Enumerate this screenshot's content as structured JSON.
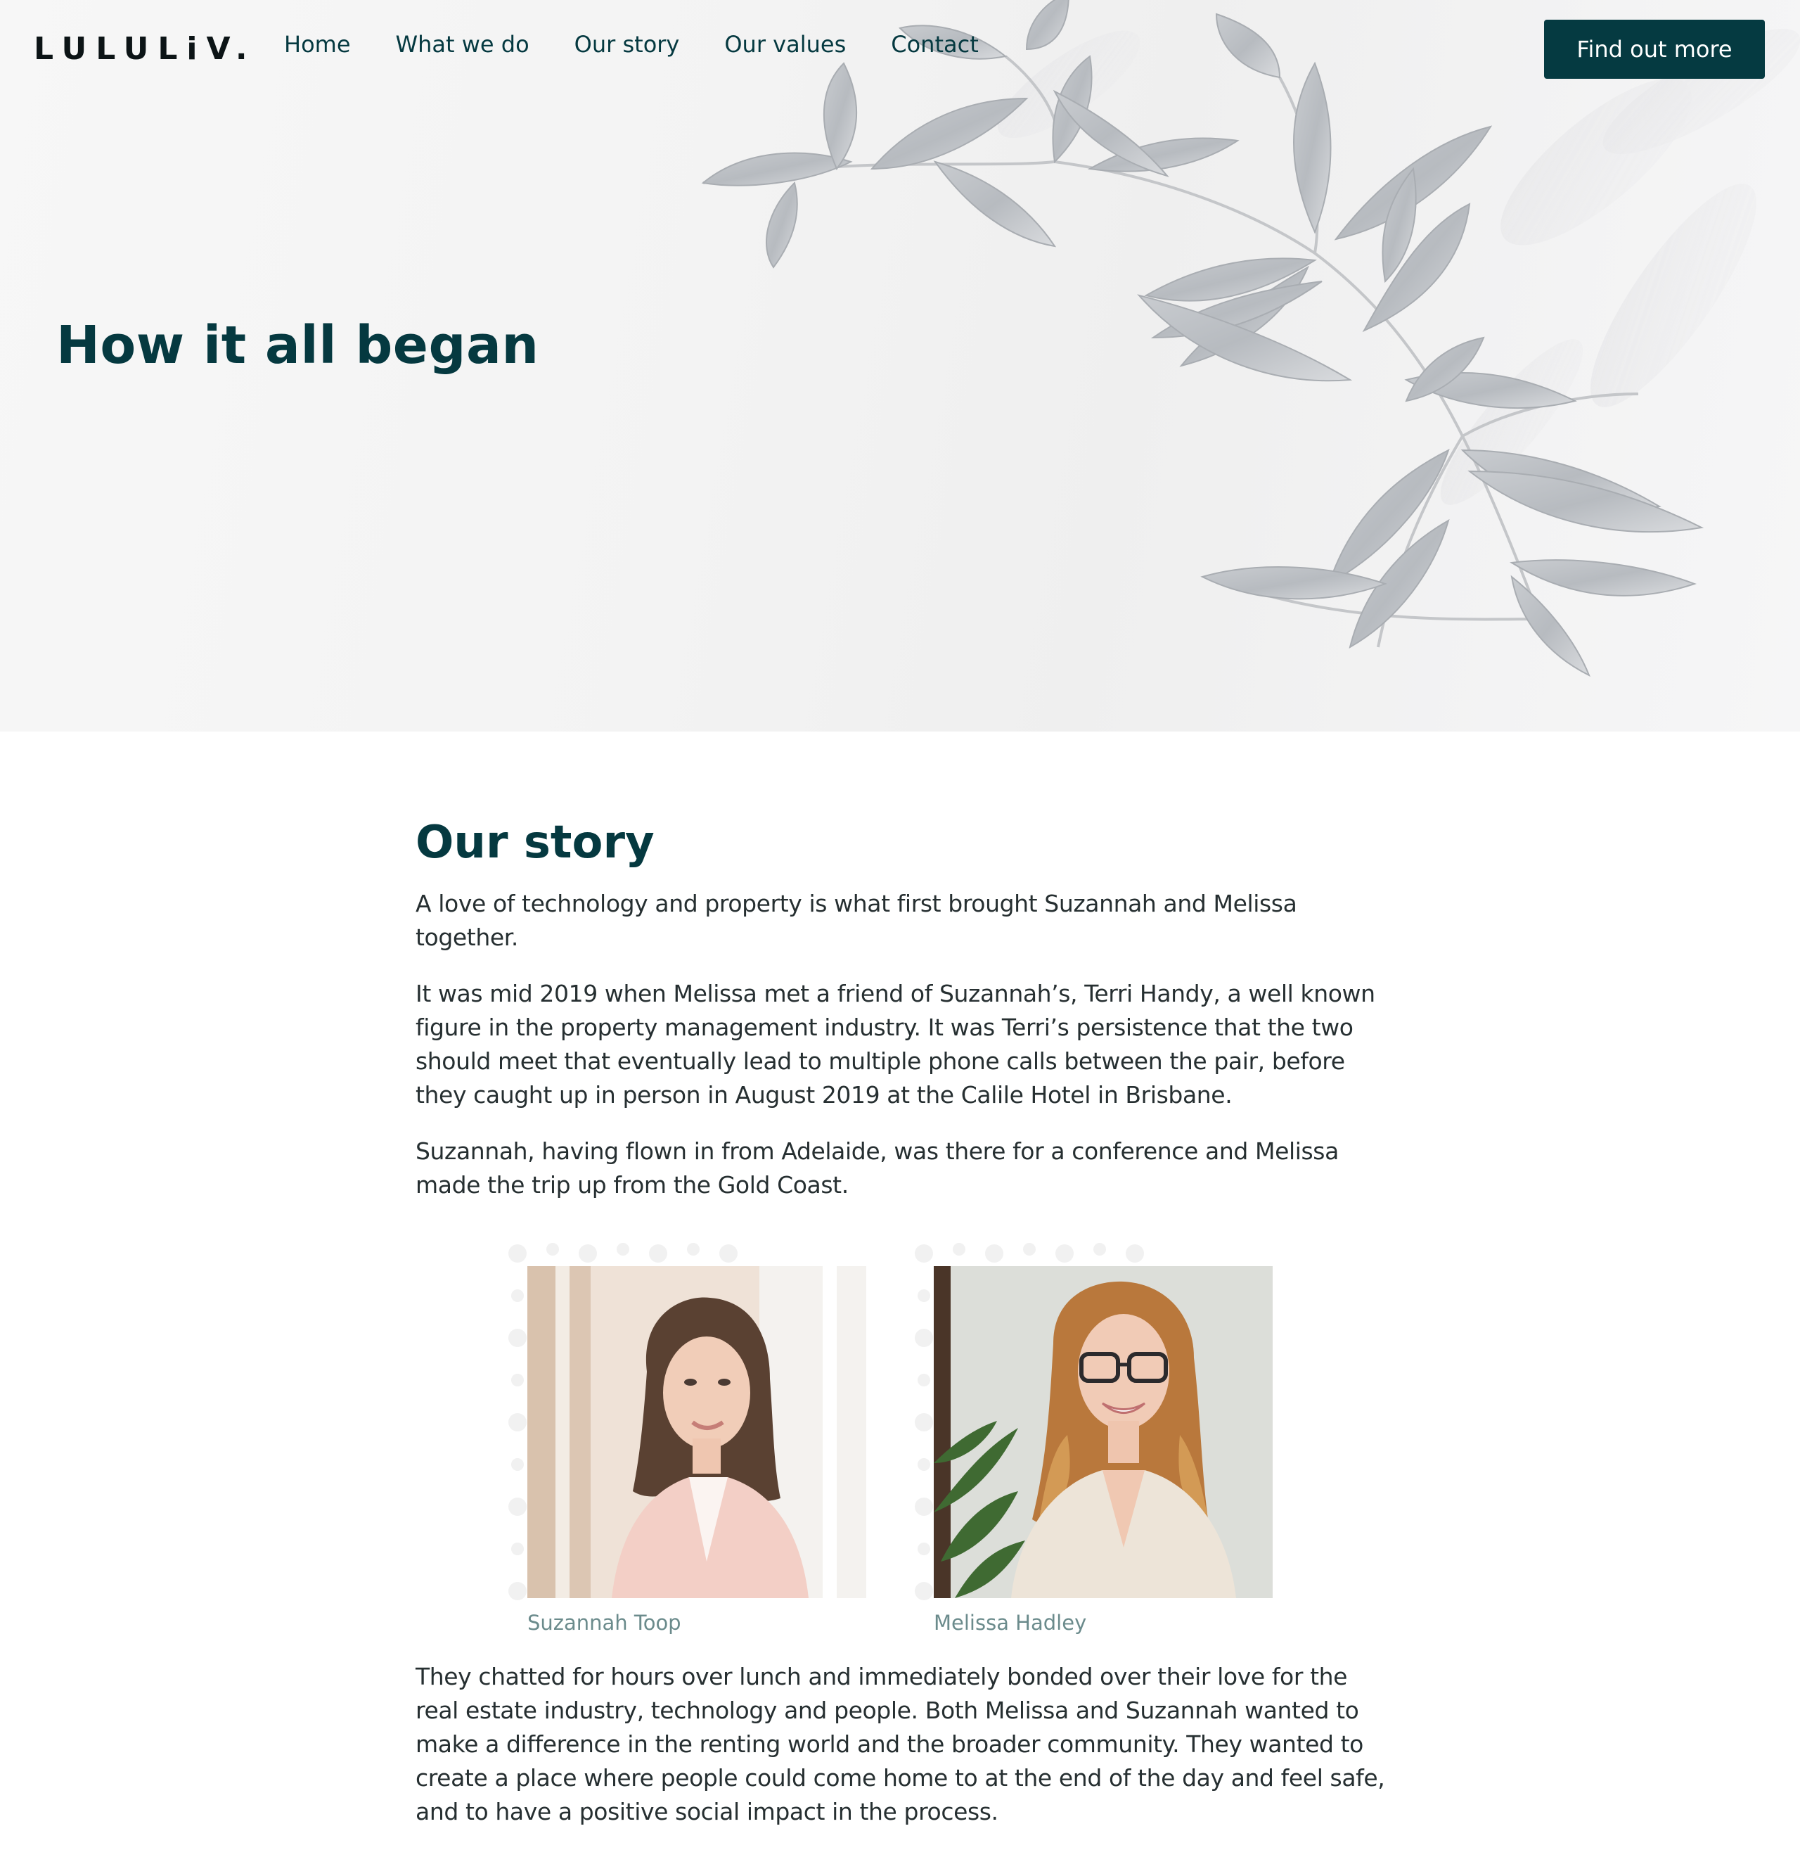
{
  "header": {
    "logo_text": "LULULiV.",
    "nav": [
      "Home",
      "What we do",
      "Our story",
      "Our values",
      "Contact"
    ],
    "cta_label": "Find out more"
  },
  "hero": {
    "title": "How it all began"
  },
  "story": {
    "title": "Our story",
    "paragraphs": [
      "A love of technology and property is what first brought Suzannah and Melissa together.",
      "It was mid 2019 when Melissa met a friend of Suzannah’s, Terri Handy, a well known figure in the property management industry. It was Terri’s persistence that the two should meet that eventually lead to multiple phone calls between the pair, before they caught up in person in August 2019 at the Calile Hotel in Brisbane.",
      "Suzannah, having flown in from Adelaide, was there for a conference and Melissa made the trip up from the Gold Coast."
    ],
    "people": [
      {
        "name": "Suzannah Toop"
      },
      {
        "name": "Melissa Hadley"
      }
    ],
    "closing": "They chatted for hours over lunch and immediately bonded over their love for the real estate industry, technology and people. Both Melissa and Suzannah wanted to make a difference in the renting world and the broader community. They wanted to create a place where people could come home to at the end of the day and feel safe, and to have a positive social impact in the process."
  },
  "colors": {
    "brand": "#053a41",
    "caption": "#6b8b8c",
    "text": "#262f31"
  }
}
